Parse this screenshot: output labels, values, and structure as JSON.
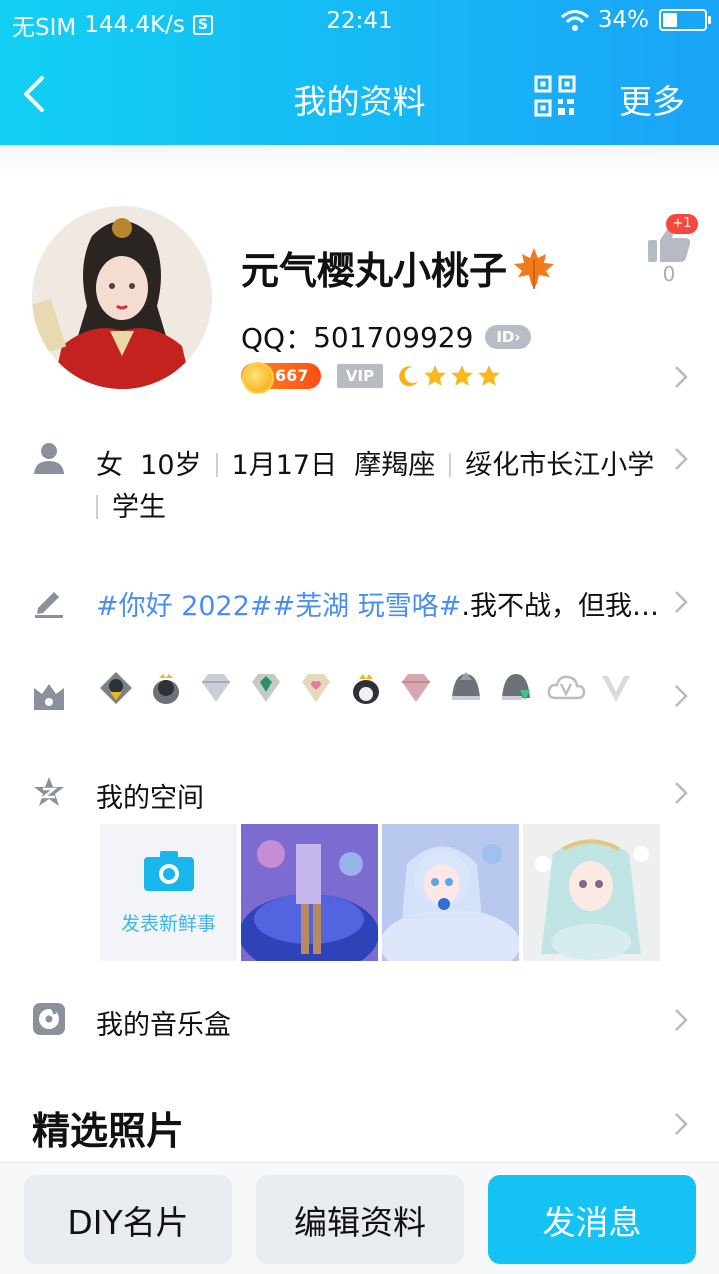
{
  "status_bar": {
    "carrier": "无SIM",
    "speed": "144.4K/s",
    "s_icon": "S",
    "time": "22:41",
    "battery": "34%",
    "battery_level": 0.34
  },
  "nav": {
    "back_icon": "chevron-left-icon",
    "title": "我的资料",
    "qr_icon": "qrcode-icon",
    "more_label": "更多"
  },
  "profile": {
    "nickname": "元气樱丸小桃子",
    "qq_label": "QQ：",
    "qq_number": "501709929",
    "id_badge": "ID",
    "level_number": "667",
    "vip_label": "VIP",
    "like_badge": "+1",
    "like_count": "0"
  },
  "info": {
    "gender": "女",
    "age": "10岁",
    "birthday": "1月17日",
    "zodiac": "摩羯座",
    "school": "绥化市长江小学",
    "occupation": "学生"
  },
  "signature": {
    "tag1": "#你好 2022#",
    "tag2": "#芜湖 玩雪咯#",
    "text": ".我不战，但我…"
  },
  "sections": {
    "space_label": "我的空间",
    "post_label": "发表新鲜事",
    "music_label": "我的音乐盒",
    "featured_label": "精选照片"
  },
  "buttons": {
    "diy": "DIY名片",
    "edit": "编辑资料",
    "message": "发消息"
  },
  "colors": {
    "header_start": "#12d0f3",
    "header_end": "#1aa4f7",
    "tag_blue": "#4a8ef2",
    "primary_button": "#14c2f3",
    "like_badge": "#f4493f"
  }
}
